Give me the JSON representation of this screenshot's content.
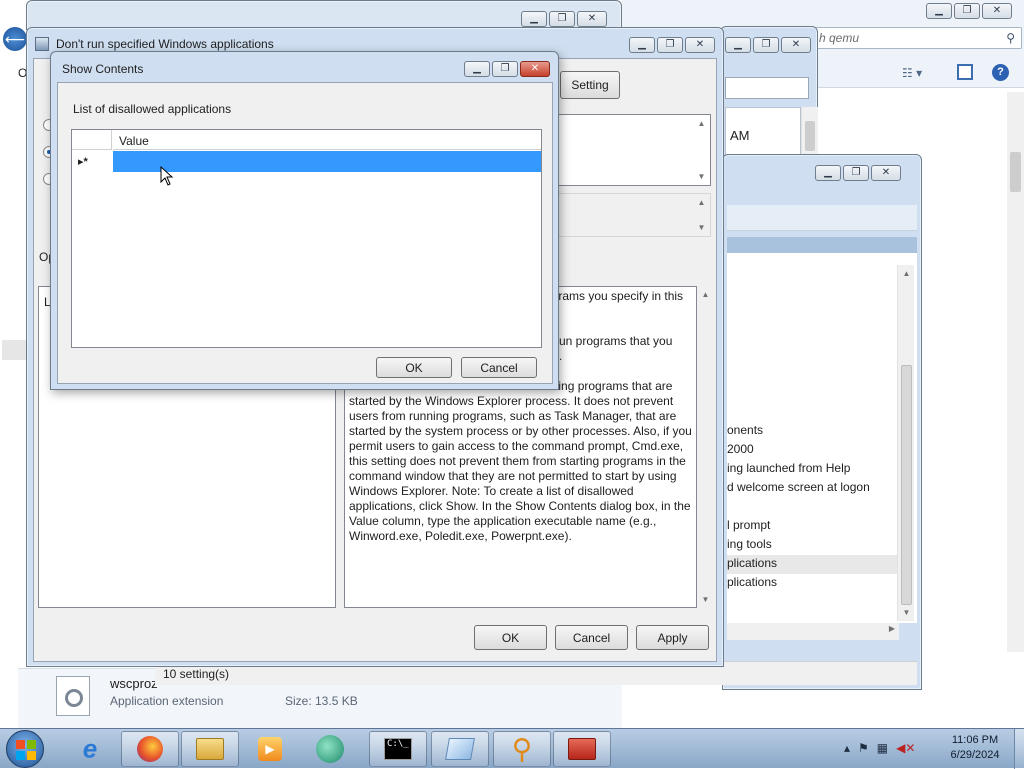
{
  "explorer": {
    "search_placeholder": "h qemu",
    "partial_left_label": "O",
    "file_name": "wscproz",
    "file_type": "Application extension",
    "file_size": "Size: 13.5 KB",
    "time_frag_1": "AM",
    "time_frag_2": "AM"
  },
  "gpedit": {
    "status_text": "10 setting(s)",
    "list_items": [
      "onents",
      "2000",
      "ing launched from Help",
      "d welcome screen at logon",
      "",
      "l prompt",
      "ing tools",
      "plications",
      "plications"
    ]
  },
  "policy_dialog": {
    "title": "Don't run specified Windows applications",
    "setting_button": "Setting",
    "options_label": "Op",
    "options_list_label": "Li",
    "help_text_lines": [
      "ograms you specify in this",
      "",
      "un programs that you",
      ".",
      "nning programs that are",
      "started by the Windows Explorer process. It does not prevent",
      "users from running programs, such as Task Manager, that are",
      "started by the system process or by other processes. Also, if you",
      "permit users to gain access to the command prompt, Cmd.exe,",
      "this setting does not prevent them from starting programs in the",
      "command window that they are not permitted to start by using",
      "Windows Explorer. Note: To create a list of disallowed",
      "applications, click Show. In the Show Contents dialog box, in the",
      "Value column, type the application executable name (e.g.,",
      "Winword.exe, Poledit.exe, Powerpnt.exe)."
    ],
    "ok_label": "OK",
    "cancel_label": "Cancel",
    "apply_label": "Apply"
  },
  "show_contents": {
    "title": "Show Contents",
    "list_label": "List of disallowed applications",
    "column_header": "Value",
    "new_row_marker": "▸*",
    "ok_label": "OK",
    "cancel_label": "Cancel"
  },
  "taskbar": {
    "time": "11:06 PM",
    "date": "6/29/2024"
  },
  "colors": {
    "selection": "#3399ff",
    "taskbar": "#9fb8d4"
  }
}
